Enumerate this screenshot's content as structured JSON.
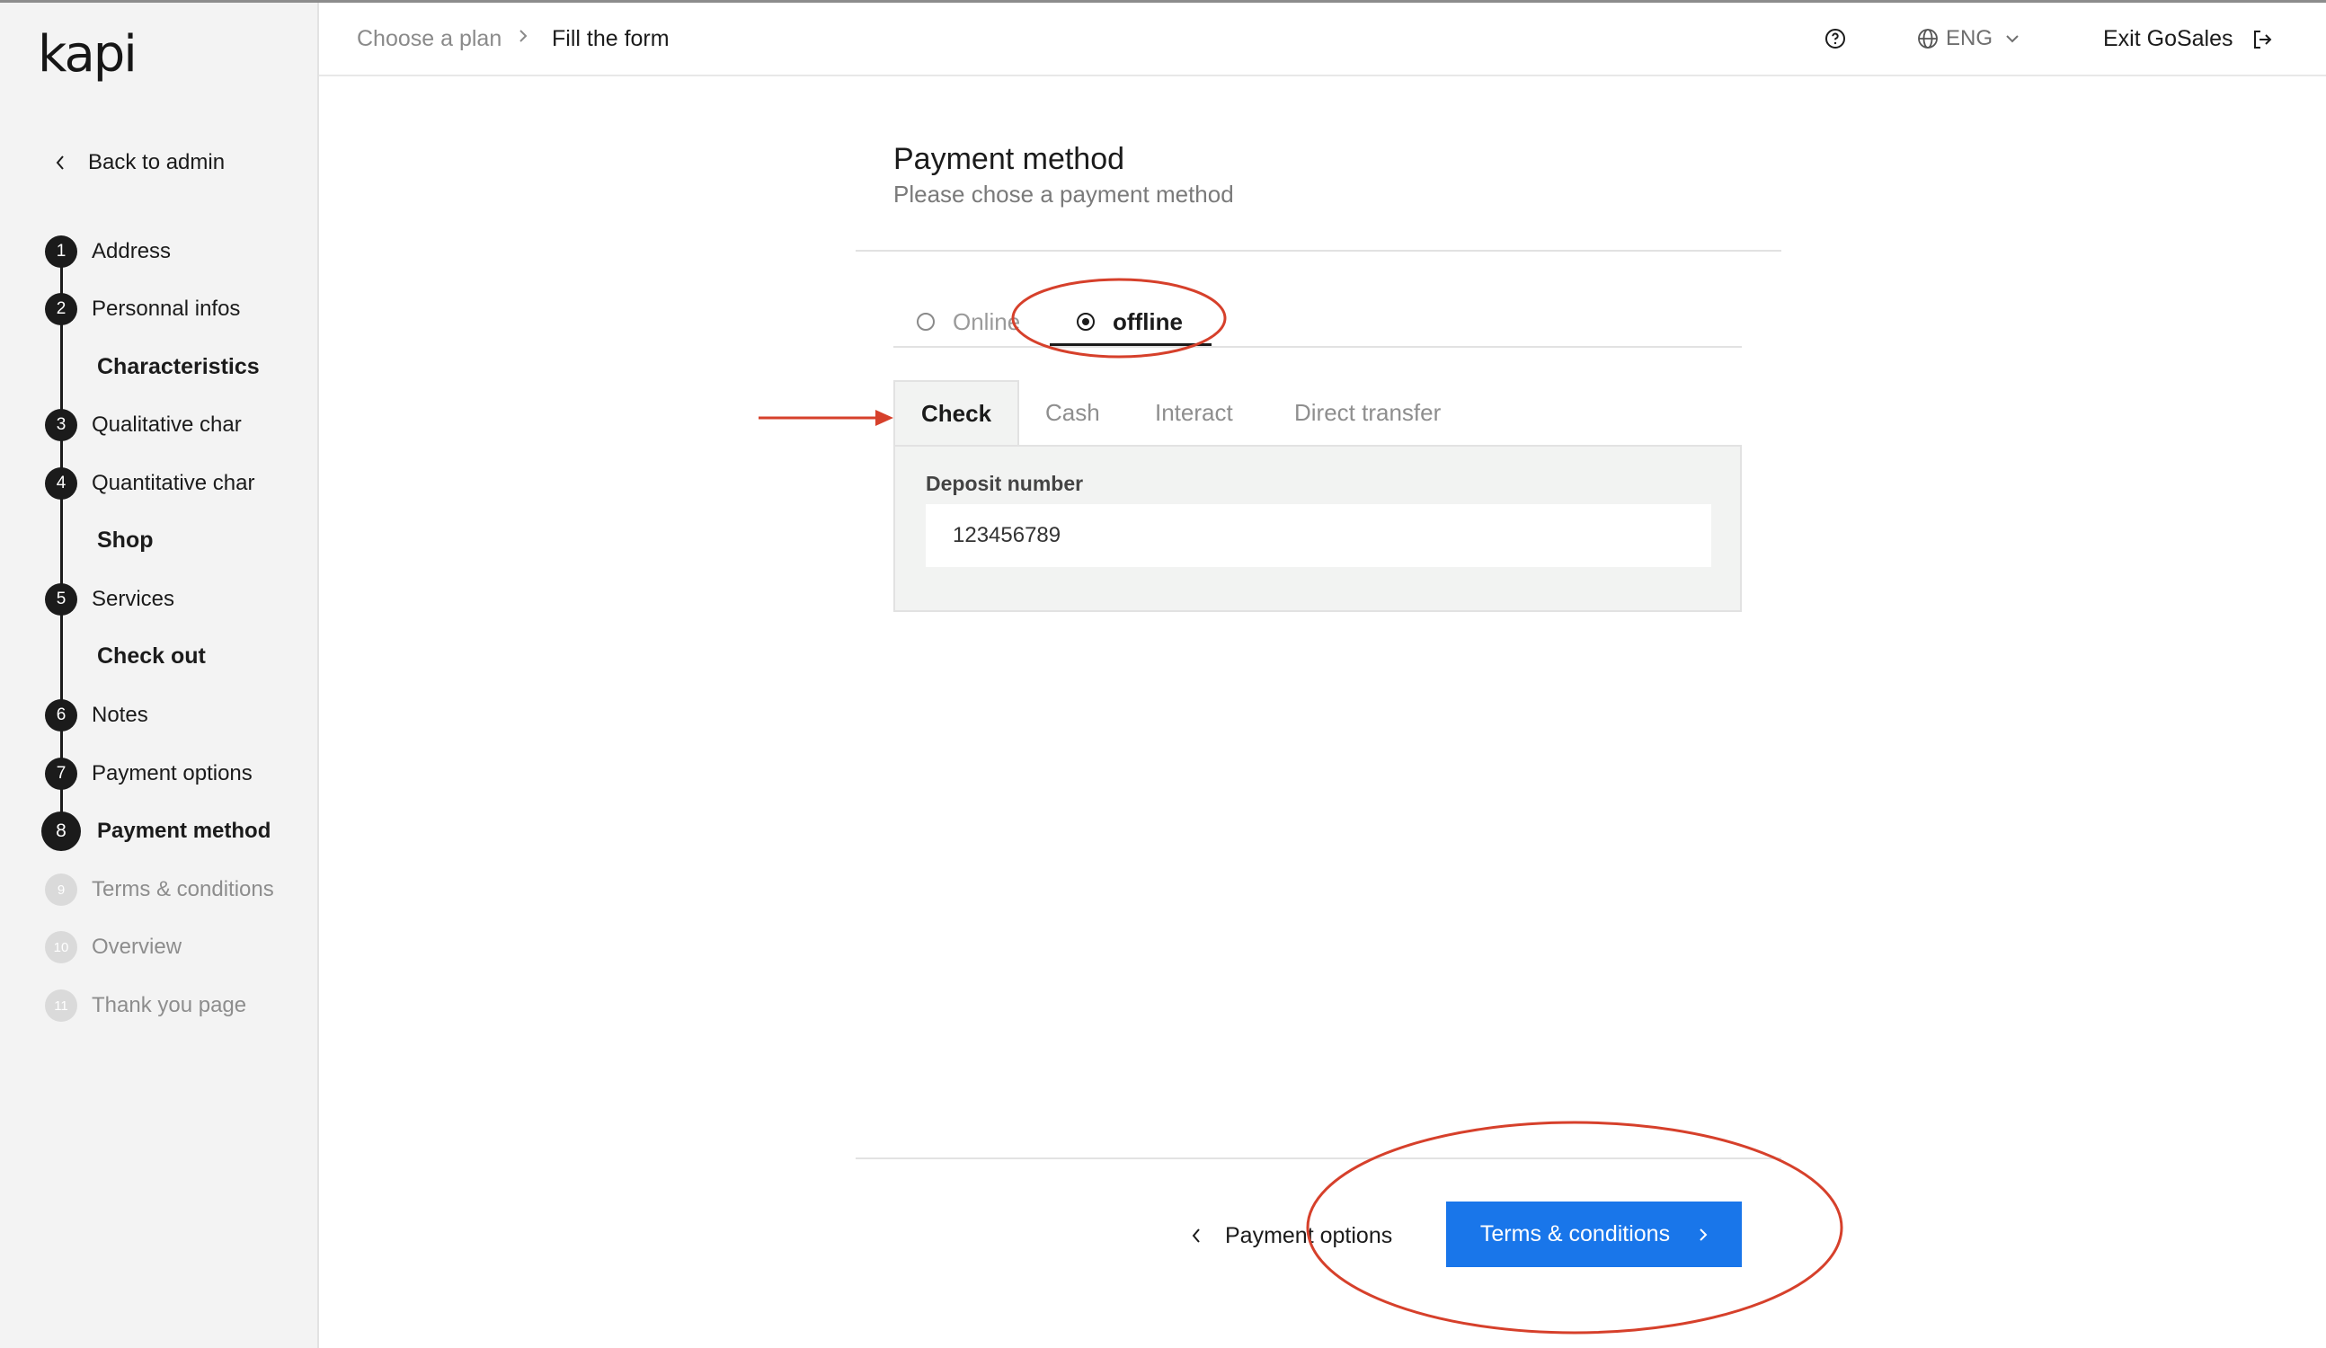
{
  "brand": {
    "logo_text": "kapi"
  },
  "sidebar": {
    "back_label": "Back to admin",
    "steps": [
      {
        "number": "1",
        "label": "Address",
        "state": "done"
      },
      {
        "number": "2",
        "label": "Personnal infos",
        "state": "done"
      },
      {
        "number": "3",
        "label": "Qualitative char",
        "state": "done"
      },
      {
        "number": "4",
        "label": "Quantitative char",
        "state": "done"
      },
      {
        "number": "5",
        "label": "Services",
        "state": "done"
      },
      {
        "number": "6",
        "label": "Notes",
        "state": "done"
      },
      {
        "number": "7",
        "label": "Payment options",
        "state": "done"
      },
      {
        "number": "8",
        "label": "Payment method",
        "state": "current"
      },
      {
        "number": "9",
        "label": "Terms & conditions",
        "state": "upcoming"
      },
      {
        "number": "10",
        "label": "Overview",
        "state": "upcoming"
      },
      {
        "number": "11",
        "label": "Thank you page",
        "state": "upcoming"
      }
    ],
    "sections": [
      "Characteristics",
      "Shop",
      "Check out"
    ]
  },
  "header": {
    "breadcrumb": [
      "Choose a plan",
      "Fill the form"
    ],
    "breadcrumb_separator": ">",
    "language": "ENG",
    "exit_label": "Exit GoSales",
    "icons": [
      "help-icon",
      "globe-icon",
      "chevron-down-icon",
      "exit-icon"
    ]
  },
  "main": {
    "title": "Payment method",
    "subtitle": "Please chose a payment method",
    "mode_tabs": [
      {
        "label": "Online",
        "selected": false
      },
      {
        "label": "offline",
        "selected": true
      }
    ],
    "method_tabs": [
      {
        "label": "Check",
        "active": true
      },
      {
        "label": "Cash",
        "active": false
      },
      {
        "label": "Interact",
        "active": false
      },
      {
        "label": "Direct transfer",
        "active": false
      }
    ],
    "deposit": {
      "label": "Deposit number",
      "value": "123456789"
    },
    "prev_label": "Payment options",
    "next_label": "Terms & conditions"
  },
  "colors": {
    "accent": "#1976ea",
    "annotation": "#d6402b",
    "sidebar_bg": "#f3f3f3",
    "panel_bg": "#f2f3f2"
  }
}
